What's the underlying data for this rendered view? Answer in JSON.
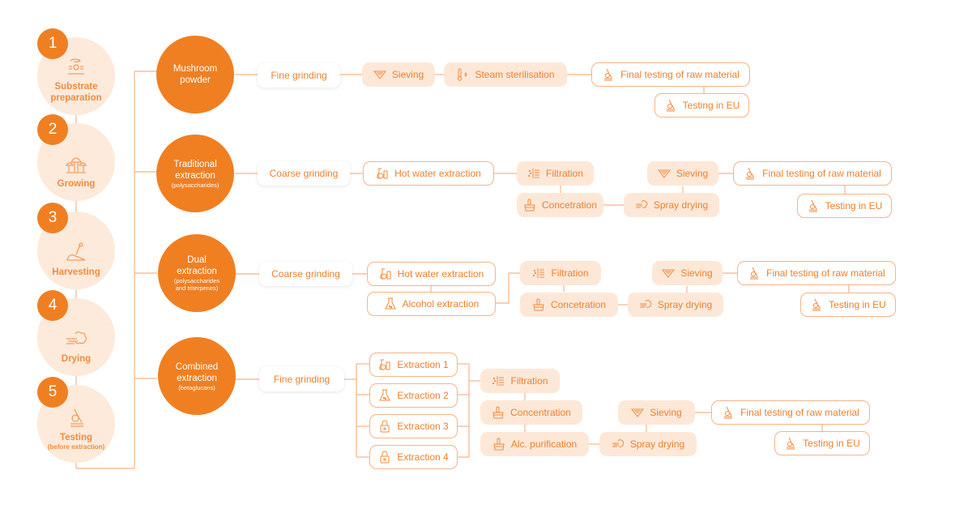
{
  "colors": {
    "accent": "#f07f22",
    "soft": "#fdeadb",
    "line": "#f5b488",
    "text": "#f07f2a"
  },
  "steps": [
    {
      "num": "1",
      "label": "Substrate",
      "label2": "preparation",
      "sub": "",
      "icon": "substrate-icon"
    },
    {
      "num": "2",
      "label": "Growing",
      "label2": "",
      "sub": "",
      "icon": "mushroom-icon"
    },
    {
      "num": "3",
      "label": "Harvesting",
      "label2": "",
      "sub": "",
      "icon": "shovel-icon"
    },
    {
      "num": "4",
      "label": "Drying",
      "label2": "",
      "sub": "",
      "icon": "wind-cloud-icon"
    },
    {
      "num": "5",
      "label": "Testing",
      "label2": "",
      "sub": "(before extraction)",
      "icon": "microscope-icon"
    }
  ],
  "methods": [
    {
      "label": "Mushroom",
      "label2": "powder",
      "sub": "",
      "sub2": ""
    },
    {
      "label": "Traditional",
      "label2": "extraction",
      "sub": "(polysaccharides)",
      "sub2": ""
    },
    {
      "label": "Dual",
      "label2": "extraction",
      "sub": "(polysaccharides",
      "sub2": "and triterpenes)"
    },
    {
      "label": "Combined",
      "label2": "extraction",
      "sub": "(betaglucans)",
      "sub2": ""
    }
  ],
  "row1": {
    "grinding": "Fine grinding",
    "sieving": "Sieving",
    "sterilisation": "Steam sterilisation",
    "final_testing": "Final testing of raw material",
    "testing_eu": "Testing in EU"
  },
  "row2": {
    "grinding": "Coarse grinding",
    "extraction": "Hot water extraction",
    "filtration": "Filtration",
    "concentration": "Concetration",
    "spray_drying": "Spray drying",
    "sieving": "Sieving",
    "final_testing": "Final testing of raw material",
    "testing_eu": "Testing in EU"
  },
  "row3": {
    "grinding": "Coarse grinding",
    "extraction_hot": "Hot water extraction",
    "extraction_alcohol": "Alcohol extraction",
    "filtration": "Filtration",
    "concentration": "Concetration",
    "spray_drying": "Spray drying",
    "sieving": "Sieving",
    "final_testing": "Final testing of raw material",
    "testing_eu": "Testing in EU"
  },
  "row4": {
    "grinding": "Fine grinding",
    "extractions": [
      "Extraction 1",
      "Extraction 2",
      "Extraction 3",
      "Extraction 4"
    ],
    "filtration": "Filtration",
    "concentration": "Concentration",
    "purification": "Alc. purification",
    "spray_drying": "Spray drying",
    "sieving": "Sieving",
    "final_testing": "Final testing of raw material",
    "testing_eu": "Testing in EU"
  }
}
